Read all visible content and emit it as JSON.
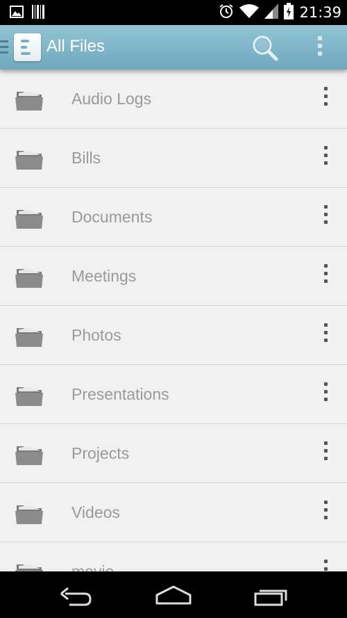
{
  "status_bar": {
    "time": "21:39",
    "icons": [
      "image-notification-icon",
      "barcode-notification-icon",
      "alarm-icon",
      "wifi-icon",
      "cell-signal-icon",
      "battery-charging-icon"
    ]
  },
  "app_bar": {
    "title": "All Files",
    "accent_color": "#7fb4c7",
    "actions": [
      "search-icon",
      "overflow-menu-icon"
    ]
  },
  "folders": [
    {
      "name": "Audio Logs"
    },
    {
      "name": "Bills"
    },
    {
      "name": "Documents"
    },
    {
      "name": "Meetings"
    },
    {
      "name": "Photos"
    },
    {
      "name": "Presentations"
    },
    {
      "name": "Projects"
    },
    {
      "name": "Videos"
    },
    {
      "name": "movie"
    }
  ],
  "nav_bar": {
    "buttons": [
      "back-icon",
      "home-icon",
      "recents-icon"
    ]
  }
}
